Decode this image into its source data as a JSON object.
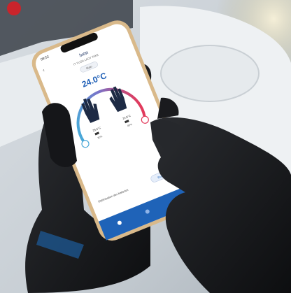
{
  "status_bar": {
    "time": "09:52"
  },
  "app": {
    "title": "Ixon",
    "device_name": "IT YUGA LADY TAKE",
    "mode_label": "Main",
    "temperature": "24.0°C",
    "left_glove": {
      "temperature": "25.6°C",
      "battery": "80%"
    },
    "right_glove": {
      "temperature": "24.8°C",
      "battery": "85%"
    },
    "footer_left": "Optimisation des batteries",
    "footer_button": "Excellente"
  },
  "colors": {
    "arc_start": "#4aa8d8",
    "arc_end": "#e23a5b",
    "accent_blue": "#1f63b8",
    "temperature_text": "#1f5fb6"
  },
  "icons": [
    "back-arrow-icon",
    "left-glove-icon",
    "right-glove-icon",
    "battery-icon",
    "bottom-nav-icons"
  ]
}
